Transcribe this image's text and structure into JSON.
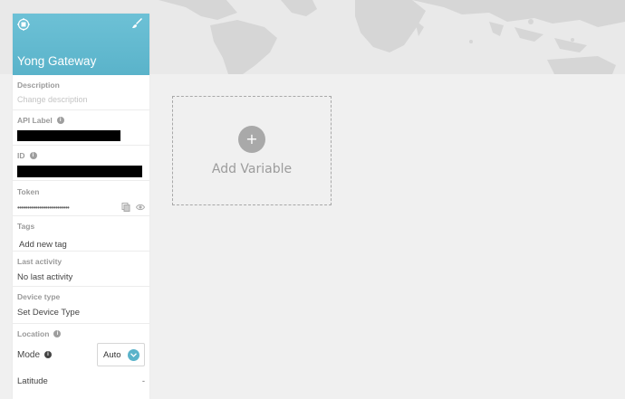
{
  "device": {
    "name": "Yong Gateway",
    "icon": "device-chip-icon",
    "edit_icon": "paint-brush-icon"
  },
  "fields": {
    "description": {
      "label": "Description",
      "placeholder": "Change description"
    },
    "api_label": {
      "label": "API Label"
    },
    "id": {
      "label": "ID"
    },
    "token": {
      "label": "Token",
      "value": "••••••••••••••••••••••••••"
    },
    "tags": {
      "label": "Tags",
      "placeholder": "Add new tag"
    },
    "last_activity": {
      "label": "Last activity",
      "value": "No last activity"
    },
    "device_type": {
      "label": "Device type",
      "value": "Set Device Type"
    },
    "location": {
      "label": "Location",
      "mode_label": "Mode",
      "mode_value": "Auto",
      "latitude_label": "Latitude",
      "latitude_value": "-"
    }
  },
  "main": {
    "add_variable": {
      "plus": "+",
      "label": "Add Variable"
    }
  },
  "colors": {
    "header": "#5ab3ca",
    "background": "#f0f0f0",
    "map_land": "#d9d9d9"
  }
}
